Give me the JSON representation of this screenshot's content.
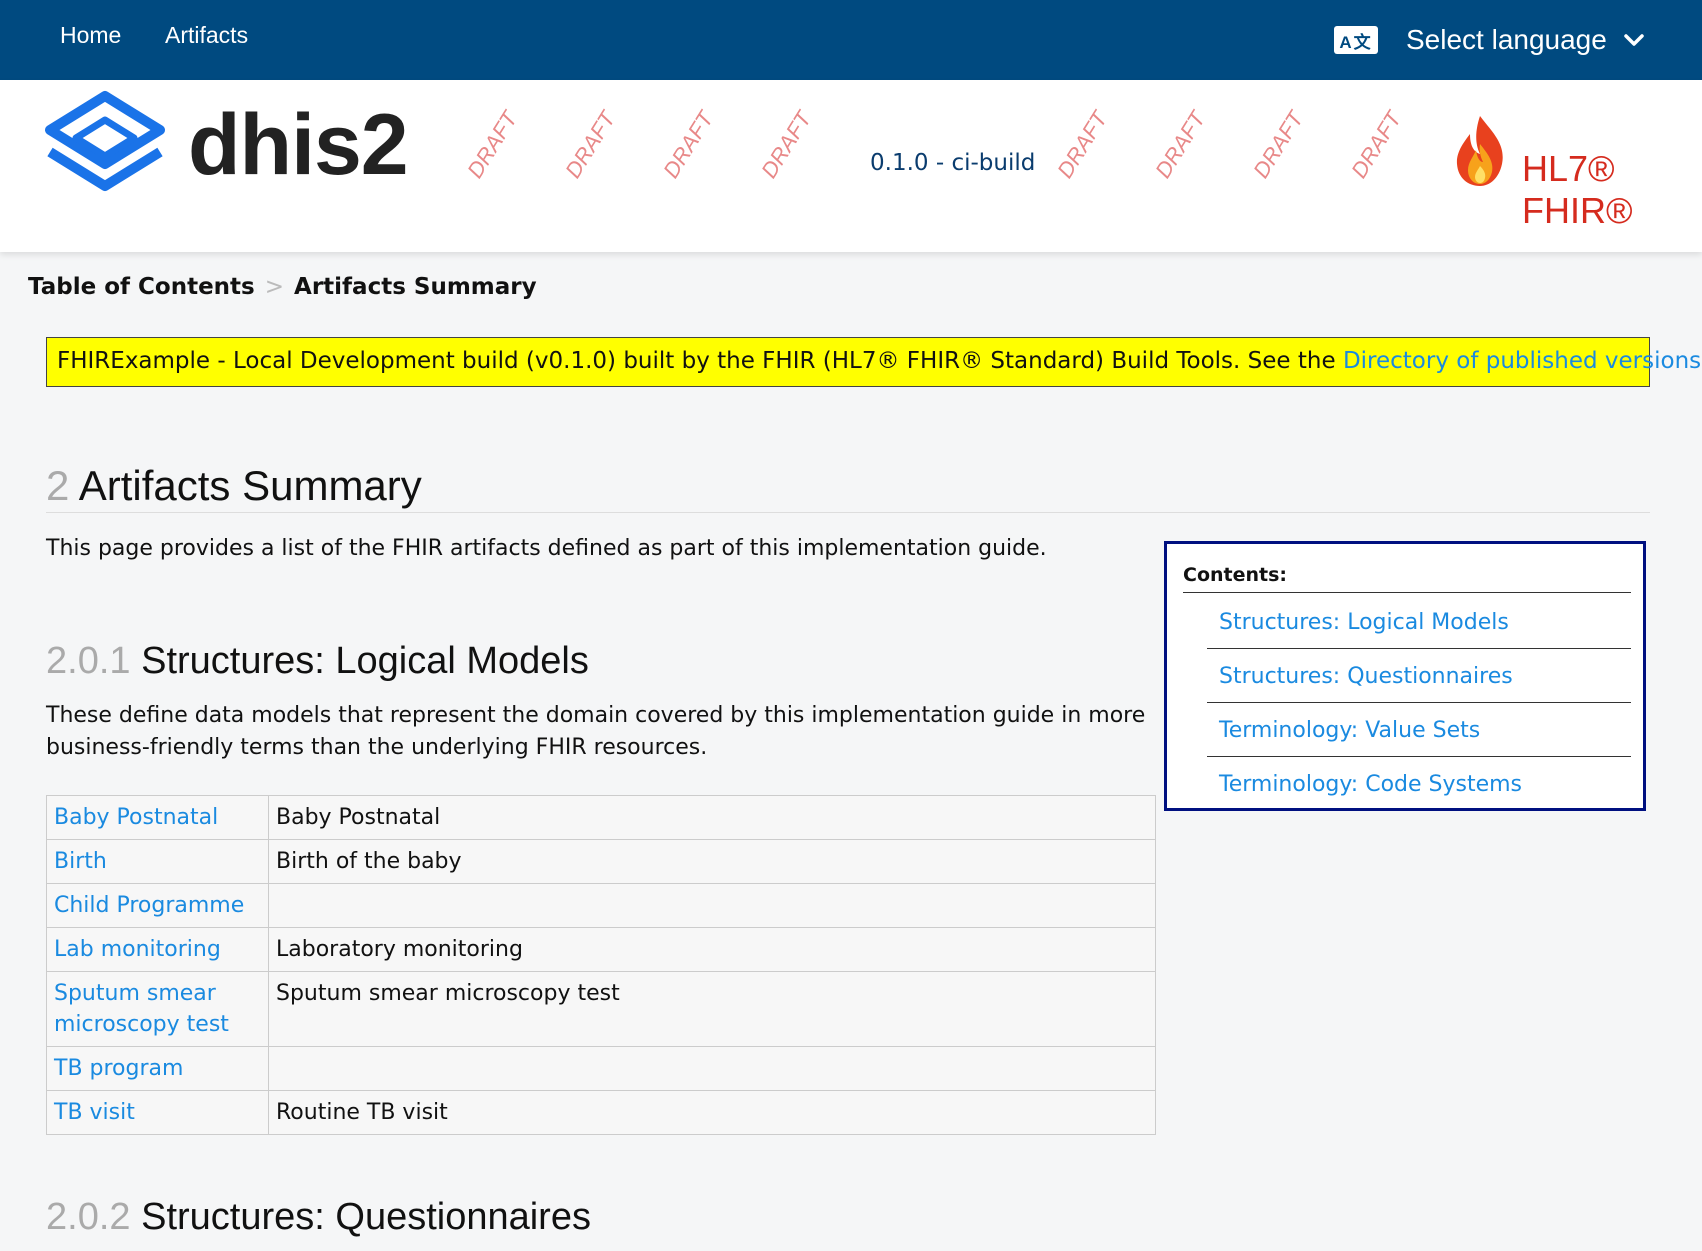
{
  "nav": {
    "home": "Home",
    "artifacts": "Artifacts",
    "language_icon": "translate-icon",
    "language_icon_text": "A文",
    "language_label": "Select language"
  },
  "header": {
    "logo_text": "dhis2",
    "draft_label": "DRAFT",
    "version": "0.1.0 - ci-build",
    "fhir_logo_text": "HL7® FHIR®"
  },
  "breadcrumb": {
    "items": [
      "Table of Contents",
      "Artifacts Summary"
    ],
    "separator": ">"
  },
  "notice": {
    "text": "FHIRExample - Local Development build (v0.1.0) built by the FHIR (HL7® FHIR® Standard) Build Tools. See the ",
    "link": "Directory of published versions"
  },
  "page": {
    "section_number": "2",
    "title": "Artifacts Summary",
    "intro": "This page provides a list of the FHIR artifacts defined as part of this implementation guide."
  },
  "logical_models": {
    "number": "2.0.1",
    "title": "Structures: Logical Models",
    "description": "These define data models that represent the domain covered by this implementation guide in more business-friendly terms than the underlying FHIR resources.",
    "rows": [
      {
        "name": "Baby Postnatal",
        "desc": "Baby Postnatal"
      },
      {
        "name": "Birth",
        "desc": "Birth of the baby"
      },
      {
        "name": "Child Programme",
        "desc": ""
      },
      {
        "name": "Lab monitoring",
        "desc": "Laboratory monitoring"
      },
      {
        "name": "Sputum smear microscopy test",
        "desc": "Sputum smear microscopy test"
      },
      {
        "name": "TB program",
        "desc": ""
      },
      {
        "name": "TB visit",
        "desc": "Routine TB visit"
      }
    ]
  },
  "questionnaires": {
    "number": "2.0.2",
    "title": "Structures: Questionnaires"
  },
  "toc": {
    "title": "Contents:",
    "items": [
      "Structures: Logical Models",
      "Structures: Questionnaires",
      "Terminology: Value Sets",
      "Terminology: Code Systems"
    ]
  },
  "colors": {
    "nav_bg": "#004a80",
    "link": "#1a8ae0",
    "notice_bg": "#ffff00",
    "toc_border": "#001080",
    "fhir_red": "#d52b1e"
  }
}
